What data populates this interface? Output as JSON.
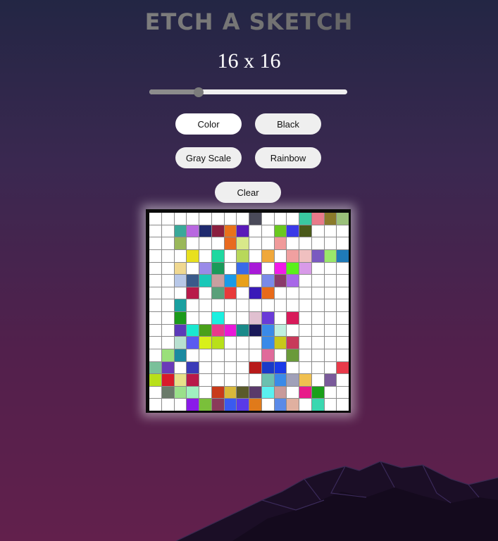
{
  "header": {
    "title": "ETCH A SKETCH"
  },
  "grid_size": {
    "label": "16 x 16",
    "value": 16,
    "slider_fraction": 0.25
  },
  "buttons": {
    "color": "Color",
    "black": "Black",
    "gray_scale": "Gray Scale",
    "rainbow": "Rainbow",
    "clear": "Clear"
  },
  "active_mode": "color",
  "palette": {
    "a": "#3aa99a",
    "b": "#b868e0",
    "c": "#1f2a6e",
    "d": "#8a1f3f",
    "e": "#e8731a",
    "f": "#5a1ab8",
    "g": "#6ac81f",
    "h": "#3a3ae8",
    "i": "#4a5a1a",
    "j": "#9ab85a",
    "k": "#e86a1f",
    "l": "#d8e88a",
    "m": "#f09a9a",
    "n": "#e8e01f",
    "o": "#1fd8a0",
    "p": "#b8d85a",
    "q": "#f0a83a",
    "r": "#f0a0a0",
    "s": "#f0c0c0",
    "t": "#7a5ac0",
    "u": "#9ae86a",
    "v": "#1f7ab8",
    "w": "#f0d890",
    "x": "#9a8ae8",
    "y": "#1a9a5a",
    "z": "#3a6ae8",
    "A": "#a81ad8",
    "B": "#f01ae8",
    "C": "#5af01a",
    "D": "#d89ae8",
    "E": "#b8c8e8",
    "F": "#3a5a8a",
    "G": "#1ac8b8",
    "H": "#c8a0a0",
    "I": "#1a9ae8",
    "J": "#e8a01a",
    "K": "#7a8ae8",
    "L": "#8a3a6a",
    "M": "#a868e8",
    "N": "#b81a4a",
    "O": "#5aa07a",
    "P": "#e83a3a",
    "Q": "#3a1ab8",
    "R": "#e86a1a",
    "S": "#1aa0a0",
    "T": "#e8e0e8",
    "U": "#1a9a1a",
    "V": "#1af0e0",
    "W": "#e0c0d0",
    "X": "#6a3ad8",
    "Y": "#d81a5a",
    "Z": "#5a3ab8",
    "0": "#1ae8d0",
    "1": "#4aa01a",
    "2": "#e83a8a",
    "3": "#e81ad8",
    "4": "#1a8a8a",
    "5": "#1a1a5a",
    "6": "#3a8ae8",
    "7": "#c0f0e0",
    "8": "#b8e0d0",
    "9": "#5a5af0",
    "!": "#d8f01a",
    "@": "#b8e01a",
    "#": "#c8c81a",
    "$": "#c83a5a",
    "%": "#9ae07a",
    "^": "#1a8aa0",
    "&": "#e06a9a",
    "*": "#6a9a3a",
    "(": "#7ac09a",
    ")": "#6a3ab8",
    "-": "#3a3ab8",
    "+": "#b81a1a",
    "=": "#1a3ac8",
    "[": "#7a5a9a",
    "]": "#e83a4a",
    "{": "#b8e01a",
    "}": "#d81a2a",
    "|": "#e8e08a",
    ":": "#b81a4a",
    ";": "#1a3ae8",
    "<": "#6ac0b0",
    ">": "#3a8ae8",
    "?": "#a0a0b8",
    "~": "#f0c050",
    "`": "#6a7a6a",
    "'": "#9ae08a",
    ",": "#a0f0c0",
    ".": "#a0a8b8",
    "/": "#c83a1a",
    "\\": "#d8b83a",
    "_": "#5a5a2a",
    "q2": "#5a3a6a",
    "r2": "#e06a1a",
    "s2": "#5af0f0",
    "t2": "#c89a9a",
    "u2": "#e81a8a",
    "v2": "#1aa01a",
    "w2": "#8a1ae8",
    "x2": "#7ac03a",
    "y2": "#8a3a5a",
    "z2": "#3a5af0",
    "A2": "#5a3ae8",
    "B2": "#e07a1a",
    "C2": "#5a8ae8",
    "D2": "#e0b0a0",
    "E2": "#3ad8b0",
    "F2": "#b868e0",
    "G2": "#9ac8d8",
    "H2": "#1aa04a",
    "I2": "#1ac01a",
    "J2": "#1a1ae8",
    "K2": "#b81a6a",
    "L2": "#1ae84a",
    "M2": "#8a7a1a",
    "N2": "#b8e89a",
    "O2": "#4a4a5a",
    "P2": "#3ac8a0",
    "Q2": "#e87a8a",
    "R2": "#8a7a2a",
    "S2": "#9ac07a"
  },
  "grid_cells": [
    [
      ".",
      ".",
      ".",
      ".",
      ".",
      ".",
      ".",
      ".",
      "O2",
      ".",
      ".",
      ".",
      "P2",
      "Q2",
      "R2",
      "S2"
    ],
    [
      ".",
      ".",
      "a",
      "b",
      "c",
      "d",
      "e",
      "f",
      ".",
      ".",
      "g",
      "h",
      "i",
      ".",
      ".",
      "."
    ],
    [
      ".",
      ".",
      "j",
      ".",
      ".",
      ".",
      "k",
      "l",
      ".",
      ".",
      "m",
      ".",
      ".",
      ".",
      ".",
      "."
    ],
    [
      ".",
      ".",
      ".",
      "n",
      ".",
      "o",
      ".",
      "p",
      ".",
      "q",
      ".",
      "r",
      "s",
      "t",
      "u",
      "v"
    ],
    [
      ".",
      ".",
      "w",
      ".",
      "x",
      "y",
      ".",
      "z",
      "A",
      ".",
      "B",
      "C",
      "D",
      ".",
      ".",
      "."
    ],
    [
      ".",
      ".",
      "E",
      "F",
      "G",
      "H",
      "I",
      "J",
      ".",
      "K",
      "L",
      "M",
      ".",
      ".",
      ".",
      "."
    ],
    [
      ".",
      ".",
      ".",
      "N",
      ".",
      "O",
      "P",
      ".",
      "Q",
      "R",
      ".",
      ".",
      ".",
      ".",
      ".",
      "."
    ],
    [
      ".",
      ".",
      "S",
      ".",
      ".",
      ".",
      ".",
      ".",
      ".",
      ".",
      ".",
      ".",
      ".",
      ".",
      ".",
      "."
    ],
    [
      ".",
      ".",
      "U",
      ".",
      ".",
      "V",
      ".",
      ".",
      "W",
      "X",
      ".",
      "Y",
      ".",
      ".",
      ".",
      "."
    ],
    [
      ".",
      ".",
      "Z",
      "0",
      "1",
      "2",
      "3",
      "4",
      "5",
      "6",
      "7",
      ".",
      ".",
      ".",
      ".",
      "."
    ],
    [
      ".",
      ".",
      "8",
      "9",
      "!",
      "@",
      ".",
      ".",
      ".",
      "6",
      "#",
      "$",
      ".",
      ".",
      ".",
      "."
    ],
    [
      ".",
      "%",
      "^",
      ".",
      ".",
      ".",
      ".",
      ".",
      ".",
      "&",
      ".",
      "*",
      ".",
      ".",
      ".",
      "."
    ],
    [
      "(",
      ")",
      ".",
      "-",
      ".",
      ".",
      ".",
      ".",
      "+",
      "=",
      ";",
      ".",
      ".",
      ".",
      ".",
      "]"
    ],
    [
      "{",
      "}",
      "|",
      ":",
      ".",
      ".",
      ".",
      ".",
      ".",
      "<",
      ">",
      "?",
      "~",
      ".",
      "[",
      "."
    ],
    [
      ".",
      "`",
      "'",
      ",",
      ".",
      "/",
      "\\",
      "_",
      "q2",
      "s2",
      "t2",
      ".",
      "u2",
      "v2",
      ".",
      "."
    ],
    [
      ".",
      ".",
      ".",
      "w2",
      "x2",
      "y2",
      "z2",
      "A2",
      "B2",
      ".",
      "C2",
      "D2",
      ".",
      "E2",
      ".",
      "."
    ],
    [
      ".",
      ".",
      ".",
      ".",
      ".",
      "F2",
      "G2",
      "H2",
      "I2",
      "J2",
      "K2",
      "L2",
      "M2",
      "N2",
      ".",
      "."
    ]
  ]
}
